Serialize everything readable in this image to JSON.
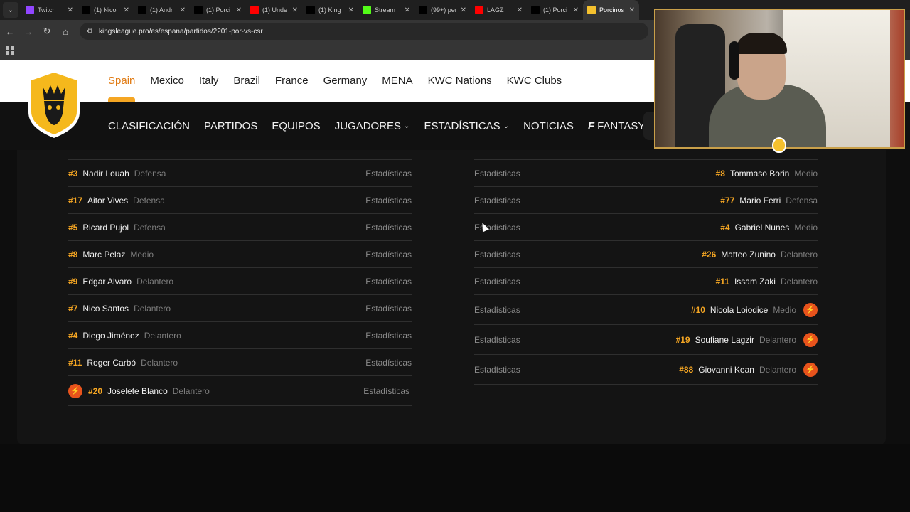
{
  "browser": {
    "tabs": [
      {
        "title": "Twitch",
        "color": "#9146ff",
        "icon": "twitch-icon"
      },
      {
        "title": "(1) Nicol",
        "color": "#000000",
        "icon": "x-icon"
      },
      {
        "title": "(1) Andr",
        "color": "#000000",
        "icon": "x-icon"
      },
      {
        "title": "(1) Porci",
        "color": "#000000",
        "icon": "x-icon"
      },
      {
        "title": "(1) Unde",
        "color": "#ff0000",
        "icon": "youtube-icon"
      },
      {
        "title": "(1) King",
        "color": "#000000",
        "icon": "x-icon"
      },
      {
        "title": "Stream",
        "color": "#53fc18",
        "icon": "kick-icon"
      },
      {
        "title": "(99+) per",
        "color": "#000000",
        "icon": "tiktok-icon"
      },
      {
        "title": "LAGZ",
        "color": "#ff0000",
        "icon": "youtube-icon"
      },
      {
        "title": "(1) Porci",
        "color": "#000000",
        "icon": "x-icon"
      },
      {
        "title": "Porcinos",
        "color": "#f5c12e",
        "icon": "kings-league-icon",
        "active": true
      }
    ],
    "url": "kingsleague.pro/es/espana/partidos/2201-por-vs-csr"
  },
  "site": {
    "leagues": [
      "Spain",
      "Mexico",
      "Italy",
      "Brazil",
      "France",
      "Germany",
      "MENA",
      "KWC Nations",
      "KWC Clubs"
    ],
    "active_league": "Spain",
    "nav": {
      "clasificacion": "CLASIFICACIÓN",
      "partidos": "PARTIDOS",
      "equipos": "EQUIPOS",
      "jugadores": "JUGADORES",
      "estadisticas": "ESTADÍSTICAS",
      "noticias": "NOTICIAS",
      "fantasy": "FANTASY"
    },
    "accent": "#f5a623",
    "sub_color": "#e8531c"
  },
  "lineup": {
    "stats_label": "Estadísticas",
    "left": [
      {
        "num": "#3",
        "name": "Nadir Louah",
        "pos": "Defensa"
      },
      {
        "num": "#17",
        "name": "Aitor Vives",
        "pos": "Defensa"
      },
      {
        "num": "#5",
        "name": "Ricard Pujol",
        "pos": "Defensa"
      },
      {
        "num": "#8",
        "name": "Marc Pelaz",
        "pos": "Medio"
      },
      {
        "num": "#9",
        "name": "Edgar Alvaro",
        "pos": "Delantero"
      },
      {
        "num": "#7",
        "name": "Nico Santos",
        "pos": "Delantero"
      },
      {
        "num": "#4",
        "name": "Diego Jiménez",
        "pos": "Delantero"
      },
      {
        "num": "#11",
        "name": "Roger Carbó",
        "pos": "Delantero"
      },
      {
        "num": "#20",
        "name": "Joselete Blanco",
        "pos": "Delantero",
        "sub": true
      }
    ],
    "right": [
      {
        "num": "#8",
        "name": "Tommaso Borin",
        "pos": "Medio"
      },
      {
        "num": "#77",
        "name": "Mario Ferri",
        "pos": "Defensa"
      },
      {
        "num": "#4",
        "name": "Gabriel Nunes",
        "pos": "Medio"
      },
      {
        "num": "#26",
        "name": "Matteo Zunino",
        "pos": "Delantero"
      },
      {
        "num": "#11",
        "name": "Issam Zaki",
        "pos": "Delantero"
      },
      {
        "num": "#10",
        "name": "Nicola Loiodice",
        "pos": "Medio",
        "sub": true
      },
      {
        "num": "#19",
        "name": "Soufiane Lagzir",
        "pos": "Delantero",
        "sub": true
      },
      {
        "num": "#88",
        "name": "Giovanni Kean",
        "pos": "Delantero",
        "sub": true
      }
    ]
  }
}
